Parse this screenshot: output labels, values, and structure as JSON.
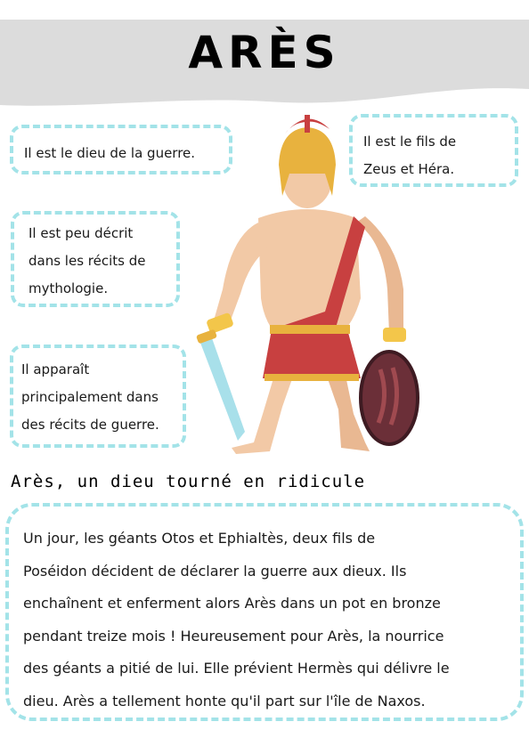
{
  "title": "ARÈS",
  "facts": [
    {
      "lines": [
        "Il est le dieu de la guerre."
      ]
    },
    {
      "lines": [
        "Il est le fils de",
        "Zeus et Héra."
      ]
    },
    {
      "lines": [
        "Il est peu décrit",
        "dans les récits de",
        "mythologie."
      ]
    },
    {
      "lines": [
        "Il apparaît",
        "principalement dans",
        "des récits de guerre."
      ]
    }
  ],
  "section_title": "Arès, un dieu tourné en ridicule",
  "story_lines": [
    "Un jour, les géants Otos et Ephialtès, deux fils de",
    "Poséidon décident de déclarer la guerre aux dieux. Ils",
    "enchaînent et enferment alors Arès dans un pot en bronze",
    "pendant treize mois ! Heureusement pour Arès, la nourrice",
    "des géants a pitié de lui. Elle prévient Hermès qui délivre le",
    "dieu. Arès a tellement honte qu'il part sur l'île de Naxos."
  ],
  "colors": {
    "border": "#a3e3e8",
    "banner": "#dcdcdc"
  },
  "illustration": "ares-warrior-illustration"
}
